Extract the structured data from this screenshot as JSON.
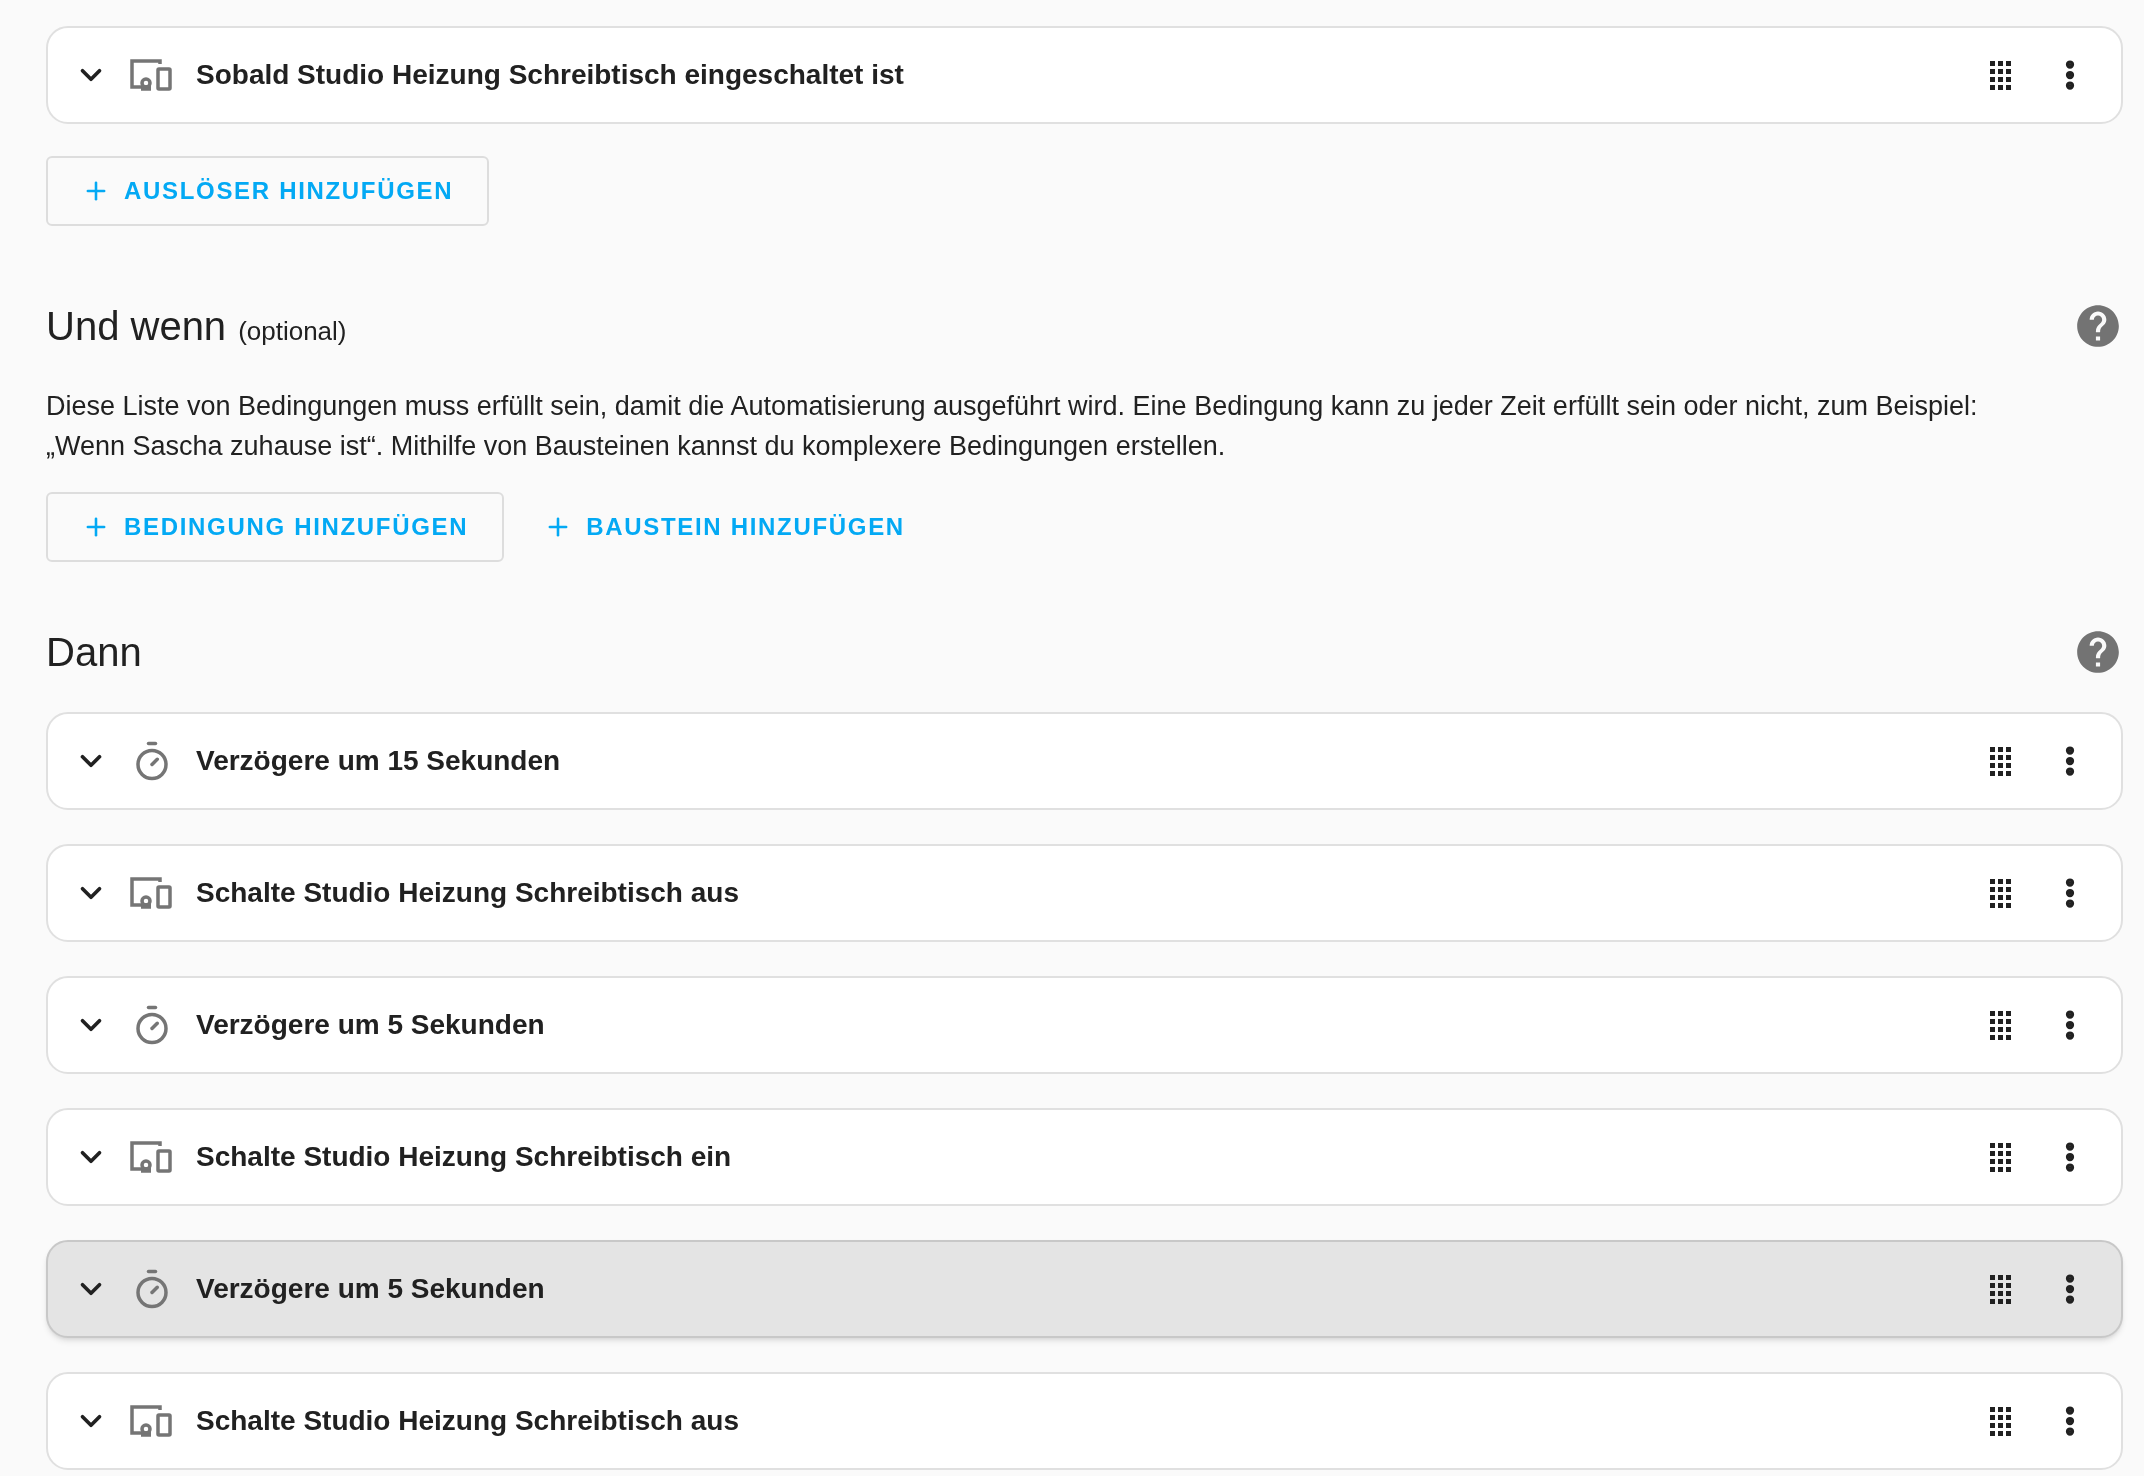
{
  "triggers": [
    {
      "kind": "device",
      "label": "Sobald Studio Heizung Schreibtisch eingeschaltet ist",
      "hovered": false
    }
  ],
  "trigger_buttons": [
    {
      "label": "AUSLÖSER HINZUFÜGEN",
      "outlined": true
    }
  ],
  "conditions": {
    "title": "Und wenn",
    "subtitle": "(optional)",
    "description": "Diese Liste von Bedingungen muss erfüllt sein, damit die Automatisierung ausgeführt wird. Eine Bedingung kann zu jeder Zeit erfüllt sein oder nicht, zum Beispiel: „Wenn Sascha zuhause ist“. Mithilfe von Bausteinen kannst du komplexere Bedingungen erstellen.",
    "buttons": [
      {
        "label": "BEDINGUNG HINZUFÜGEN",
        "outlined": true
      },
      {
        "label": "BAUSTEIN HINZUFÜGEN",
        "outlined": false
      }
    ]
  },
  "actions": {
    "title": "Dann",
    "items": [
      {
        "kind": "delay",
        "label": "Verzögere um 15 Sekunden",
        "hovered": false
      },
      {
        "kind": "device",
        "label": "Schalte Studio Heizung Schreibtisch aus",
        "hovered": false
      },
      {
        "kind": "delay",
        "label": "Verzögere um 5 Sekunden",
        "hovered": false
      },
      {
        "kind": "device",
        "label": "Schalte Studio Heizung Schreibtisch ein",
        "hovered": false
      },
      {
        "kind": "delay",
        "label": "Verzögere um 5 Sekunden",
        "hovered": true
      },
      {
        "kind": "device",
        "label": "Schalte Studio Heizung Schreibtisch aus",
        "hovered": false
      }
    ]
  }
}
